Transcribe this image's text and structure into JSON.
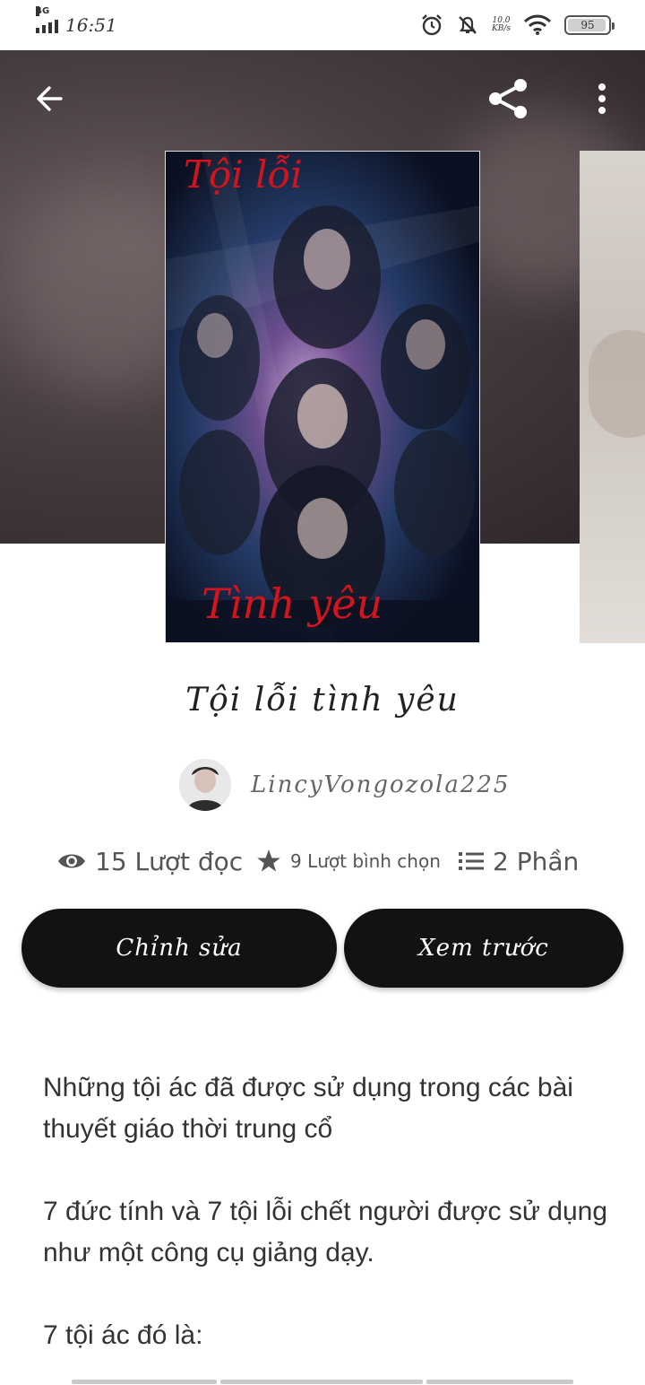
{
  "status_bar": {
    "network": "4G",
    "time": "16:51",
    "speed_value": "10.0",
    "speed_unit": "KB/s",
    "battery": "95",
    "icons": [
      "signal-icon",
      "alarm-icon",
      "bell-muted-icon",
      "wifi-icon",
      "battery-icon"
    ]
  },
  "toolbar": {
    "back_icon": "arrow-left-icon",
    "share_icon": "share-icon",
    "more_icon": "more-vertical-icon"
  },
  "cover": {
    "title_top": "Tội lỗi",
    "title_bottom": "Tình yêu"
  },
  "story": {
    "title": "Tội lỗi tình yêu",
    "author": "LincyVongozola225",
    "reads": "15 Lượt đọc",
    "votes": "9 Lượt bình chọn",
    "parts": "2 Phần"
  },
  "actions": {
    "edit_label": "Chỉnh sửa",
    "preview_label": "Xem trước"
  },
  "description": [
    "Những tội ác đã được sử dụng trong các bài thuyết giáo thời trung cổ",
    "7 đức tính và 7 tội lỗi chết người được sử dụng như một công cụ giảng dạy.",
    "7 tội ác đó là:"
  ],
  "colors": {
    "button_bg": "#121212",
    "cover_red": "#d2141e",
    "hero_bg": "#4a3f42"
  }
}
